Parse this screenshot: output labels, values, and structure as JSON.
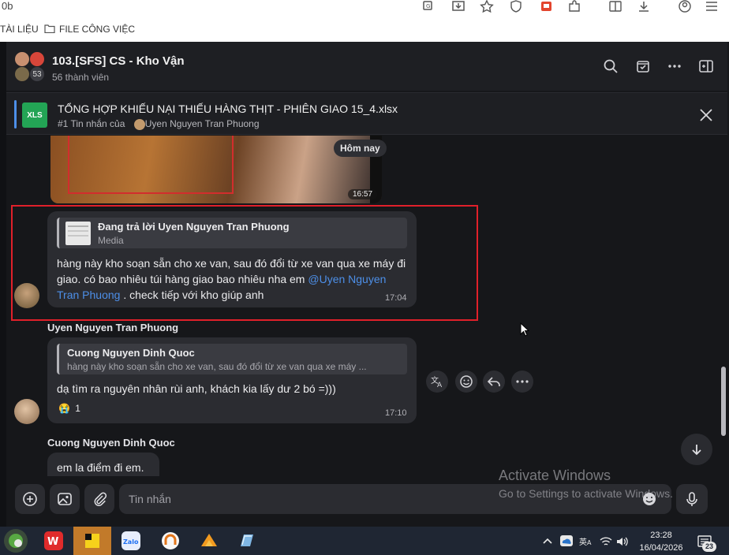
{
  "browser": {
    "url_fragment": "0b",
    "bookmarks": [
      {
        "label": "TÀI LIỆU"
      },
      {
        "label": "FILE CÔNG VIỆC"
      }
    ]
  },
  "chat": {
    "title": "103.[SFS] CS - Kho Vận",
    "members": "56 thành viên",
    "avatar_count": "53"
  },
  "pinned": {
    "file_badge": "XLS",
    "title": "TỔNG HỢP KHIẾU NẠI THIẾU HÀNG THỊT - PHIÊN GIAO 15_4.xlsx",
    "subtitle_prefix": "#1 Tin nhắn của",
    "subtitle_name": "Uyen Nguyen Tran Phuong"
  },
  "messages": {
    "date_chip": "Hôm nay",
    "image_time": "16:57",
    "msg1": {
      "reply_title": "Đang trả lời Uyen Nguyen Tran Phuong",
      "reply_sub": "Media",
      "text_part1": "hàng này kho soạn sẵn cho xe van, sau đó đổi từ xe van qua xe máy đi giao.  có bao nhiêu túi hàng giao bao nhiêu nha em ",
      "mention": "@Uyen Nguyen Tran Phuong",
      "text_part2": " . check tiếp với kho giúp anh",
      "time": "17:04"
    },
    "msg2": {
      "sender": "Uyen Nguyen Tran Phuong",
      "quote_title": "Cuong Nguyen Dinh Quoc",
      "quote_text": "hàng này kho soạn sẵn cho xe van, sau đó đổi từ xe van qua xe máy ...",
      "text": "dạ tìm ra nguyên nhân rùi anh, khách kia lấy dư 2 bó =)))",
      "reaction_emoji": "😭",
      "reaction_count": "1",
      "time": "17:10"
    },
    "msg3": {
      "sender": "Cuong Nguyen Dinh Quoc",
      "text": "em la điểm đi em."
    }
  },
  "composer": {
    "placeholder": "Tin nhắn"
  },
  "watermark": {
    "title": "Activate Windows",
    "subtitle": "Go to Settings to activate Windows."
  },
  "taskbar": {
    "time": "23:28",
    "date": "16/04/2026",
    "notif_count": "23",
    "lang": "ENG"
  },
  "colors": {
    "accent_blue": "#4d8fe8",
    "highlight_red": "#e0202a",
    "bubble": "#2b2c31",
    "app_bg": "#16171a"
  }
}
